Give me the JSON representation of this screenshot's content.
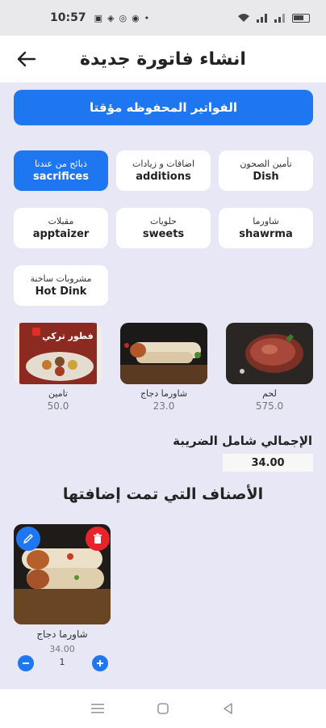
{
  "status": {
    "time": "10:57"
  },
  "appbar": {
    "title": "انشاء فاتورة جديدة"
  },
  "saved_invoices_button": "الفواتير المحفوظه مؤقتا",
  "categories": [
    {
      "ar": "تأمين الصحون",
      "en": "Dish",
      "active": false
    },
    {
      "ar": "اضافات و زيادات",
      "en": "additions",
      "active": false
    },
    {
      "ar": "ذبائح من عندنا",
      "en": "sacrifices",
      "active": true
    },
    {
      "ar": "شاورما",
      "en": "shawrma",
      "active": false
    },
    {
      "ar": "حلويات",
      "en": "sweets",
      "active": false
    },
    {
      "ar": "مقبلات",
      "en": "apptaizer",
      "active": false
    },
    {
      "ar": "مشروبات ساخنة",
      "en": "Hot Dink",
      "active": false
    }
  ],
  "products": [
    {
      "name": "لحم",
      "price": "575.0"
    },
    {
      "name": "شاورما دجاج",
      "price": "23.0"
    },
    {
      "name": "تامين",
      "price": "50.0"
    }
  ],
  "promo_image_text": "فطور تركي",
  "total": {
    "label": "الإجمالي شامل الضريبة",
    "value": "34.00"
  },
  "added_section_title": "الأصناف التي تمت إضافتها",
  "added_items": [
    {
      "name": "شاورما دجاج",
      "price": "34.00",
      "qty": "1"
    }
  ],
  "colors": {
    "accent": "#1e77f0",
    "delete": "#e8242b",
    "background": "#e7e7f5"
  },
  "icons": {
    "back": "arrow-left-icon",
    "edit": "pencil-icon",
    "delete": "trash-icon",
    "decrease": "minus-icon",
    "increase": "plus-icon"
  }
}
